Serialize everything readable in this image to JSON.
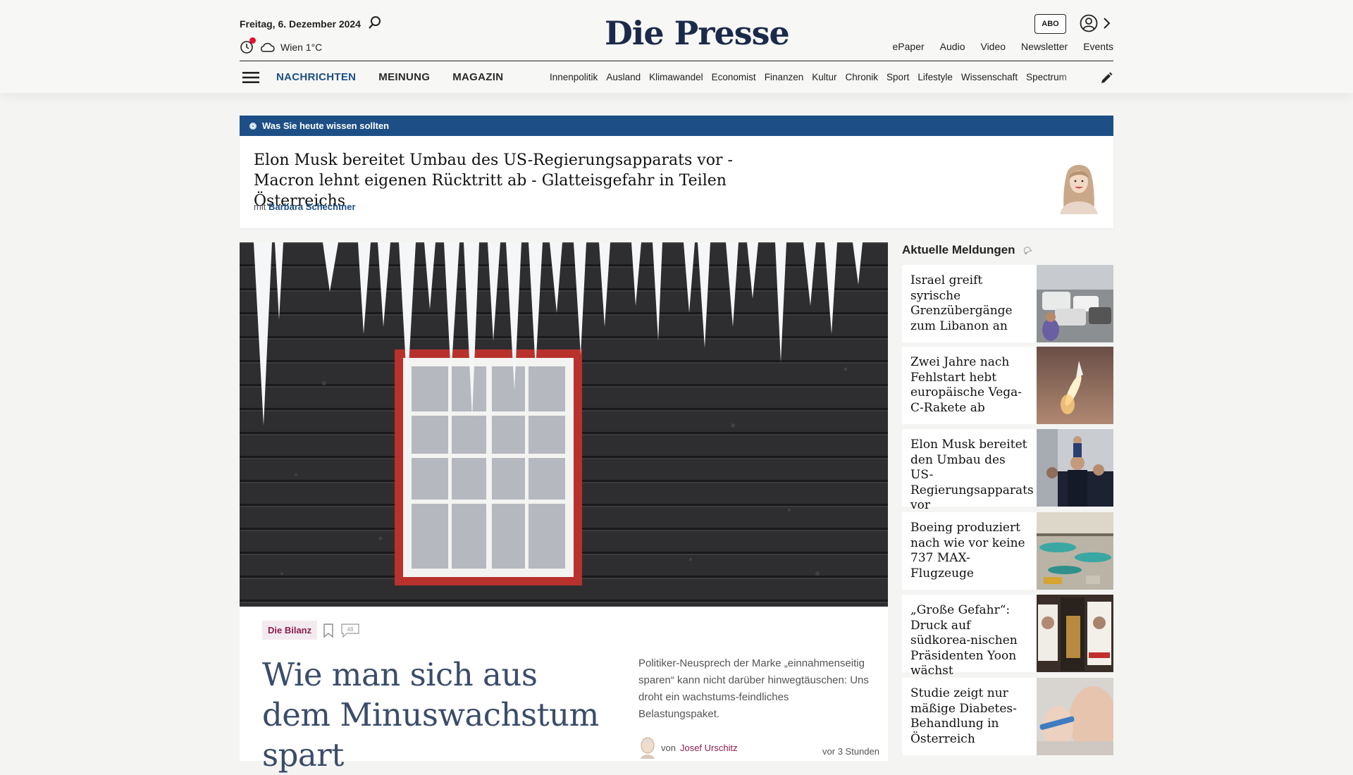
{
  "header": {
    "date": "Freitag, 6. Dezember 2024",
    "weather": "Wien 1°C",
    "logo": "Die Presse",
    "abo_label": "ABO",
    "top_links": [
      "ePaper",
      "Audio",
      "Video",
      "Newsletter",
      "Events"
    ],
    "main_nav": [
      "NACHRICHTEN",
      "MEINUNG",
      "MAGAZIN"
    ],
    "sub_nav": [
      "Innenpolitik",
      "Ausland",
      "Klimawandel",
      "Economist",
      "Finanzen",
      "Kultur",
      "Chronik",
      "Sport",
      "Lifestyle",
      "Wissenschaft",
      "Spectrum"
    ],
    "accent_color": "#1d4f86"
  },
  "briefing": {
    "bar_label": "Was Sie heute wissen sollten",
    "title": "Elon Musk bereitet Umbau des US-Regierungsapparats vor - Macron lehnt eigenen Rücktritt ab - Glatteisgefahr in Teilen Österreichs",
    "author_prefix": "mit",
    "author": "Barbara Schechtner"
  },
  "hero": {
    "tag": "Die Bilanz",
    "comment_count": "48",
    "title": "Wie man sich aus dem Minuswachstum spart",
    "teaser": "Politiker-Neusprech der Marke „einnahmenseitig sparen“ kann nicht darüber hinwegtäuschen: Uns droht ein wachstums-feindliches Belastungspaket.",
    "byline_prefix": "von",
    "author": "Josef Urschitz",
    "time": "vor 3 Stunden",
    "tag_color": "#8a1d4d"
  },
  "sidebar": {
    "heading": "Aktuelle Meldungen",
    "items": [
      {
        "title": "Israel greift syrische Grenzübergänge zum Libanon an"
      },
      {
        "title": "Zwei Jahre nach Fehlstart hebt europäische Vega-C-Rakete ab"
      },
      {
        "title": "Elon Musk bereitet den Umbau des US-Regierungsapparats vor"
      },
      {
        "title": "Boeing produziert nach wie vor keine 737 MAX-Flugzeuge"
      },
      {
        "title": "„Große Gefahr“: Druck auf südkorea-nischen Präsidenten Yoon wächst"
      },
      {
        "title": "Studie zeigt nur mäßige Diabetes-Behandlung in Österreich"
      }
    ]
  }
}
